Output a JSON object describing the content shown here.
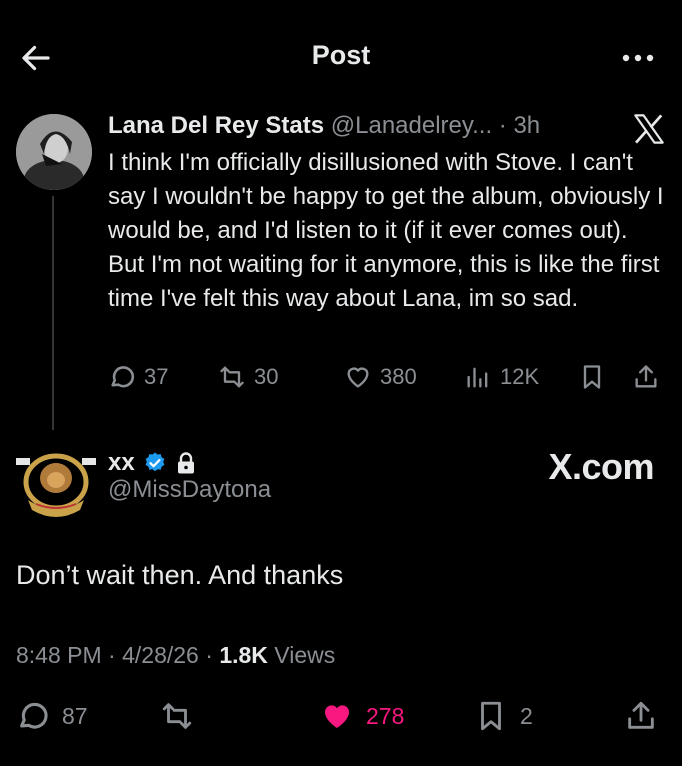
{
  "header": {
    "title": "Post"
  },
  "quoted": {
    "name": "Lana Del Rey Stats",
    "handle": "@Lanadelrey...",
    "time": "· 3h",
    "text": "I think I'm officially disillusioned with Stove. I can't say I wouldn't be happy to get the album, obviously I would be, and I'd listen to it (if it ever comes out). But I'm not waiting for it anymore, this is like the first time I've felt this way about Lana, im so sad.",
    "replies": "37",
    "reposts": "30",
    "likes": "380",
    "views": "12K"
  },
  "post": {
    "name": "xx",
    "handle": "@MissDaytona",
    "watermark": "X.com",
    "text": "Don’t wait then. And thanks",
    "time": "8:48 PM",
    "date": "4/28/26",
    "views_count": "1.8K",
    "views_label": "Views",
    "replies": "87",
    "likes": "278",
    "bookmarks": "2"
  },
  "colors": {
    "background": "#000000",
    "text": "#e7e9ea",
    "muted": "#8b8f94",
    "like": "#f91880",
    "verified": "#1d9bf0"
  },
  "icons": [
    "back-arrow-icon",
    "more-icon",
    "x-logo-icon",
    "reply-icon",
    "repost-icon",
    "like-icon",
    "views-icon",
    "bookmark-icon",
    "share-icon",
    "verified-badge-icon",
    "lock-icon"
  ]
}
